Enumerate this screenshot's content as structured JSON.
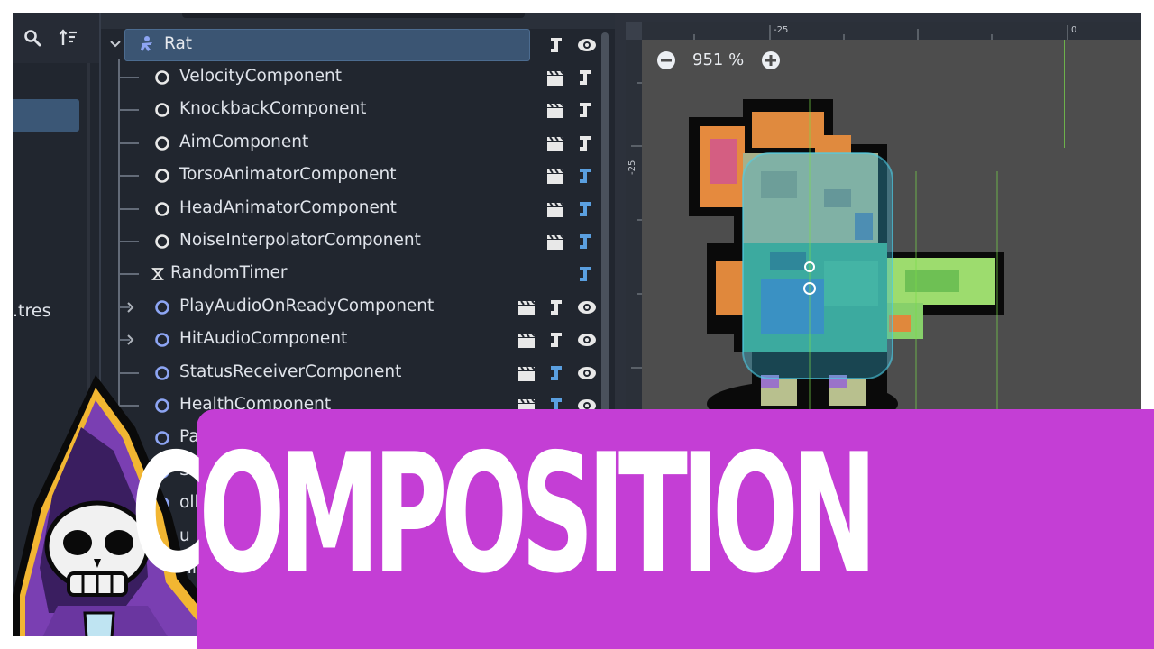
{
  "file_panel": {
    "search_icon": "search-icon",
    "sort_icon": "sort-icon",
    "file_label": ".tres"
  },
  "scene_tree": {
    "root": {
      "label": "Rat",
      "icon": "character-body-icon"
    },
    "nodes": [
      {
        "label": "VelocityComponent",
        "icon": "node-circle-icon",
        "circle_color": "#e8e8e8"
      },
      {
        "label": "KnockbackComponent",
        "icon": "node-circle-icon",
        "circle_color": "#e8e8e8"
      },
      {
        "label": "AimComponent",
        "icon": "node-circle-icon",
        "circle_color": "#e8e8e8"
      },
      {
        "label": "TorsoAnimatorComponent",
        "icon": "node-circle-icon",
        "circle_color": "#e8e8e8"
      },
      {
        "label": "HeadAnimatorComponent",
        "icon": "node-circle-icon",
        "circle_color": "#e8e8e8"
      },
      {
        "label": "NoiseInterpolatorComponent",
        "icon": "node-circle-icon",
        "circle_color": "#e8e8e8"
      },
      {
        "label": "RandomTimer",
        "icon": "timer-icon",
        "circle_color": "#e8e8e8"
      },
      {
        "label": "PlayAudioOnReadyComponent",
        "icon": "node2d-circle-icon",
        "circle_color": "#8da5f3"
      },
      {
        "label": "HitAudioComponent",
        "icon": "node2d-circle-icon",
        "circle_color": "#8da5f3"
      },
      {
        "label": "StatusReceiverComponent",
        "icon": "node2d-circle-icon",
        "circle_color": "#8da5f3"
      },
      {
        "label": "HealthComponent",
        "icon": "node2d-circle-icon",
        "circle_color": "#8da5f3"
      },
      {
        "label": "Pathfi",
        "icon": "node2d-circle-icon",
        "circle_color": "#8da5f3"
      },
      {
        "label": "Shac",
        "icon": "node2d-circle-icon",
        "circle_color": "#8da5f3"
      },
      {
        "label": "olli",
        "icon": "node2d-circle-icon",
        "circle_color": "#8da5f3"
      },
      {
        "label": "u",
        "icon": "node2d-circle-icon",
        "circle_color": "#8da5f3"
      },
      {
        "label": "Hi",
        "icon": "node2d-circle-icon",
        "circle_color": "#8da5f3"
      }
    ]
  },
  "viewport": {
    "zoom": "951 %",
    "ruler_top_labels": [
      "-25",
      "0"
    ],
    "ruler_left_label": "-25"
  },
  "overlay": {
    "title": "COMPOSITION",
    "banner_color": "#c43ed5"
  }
}
